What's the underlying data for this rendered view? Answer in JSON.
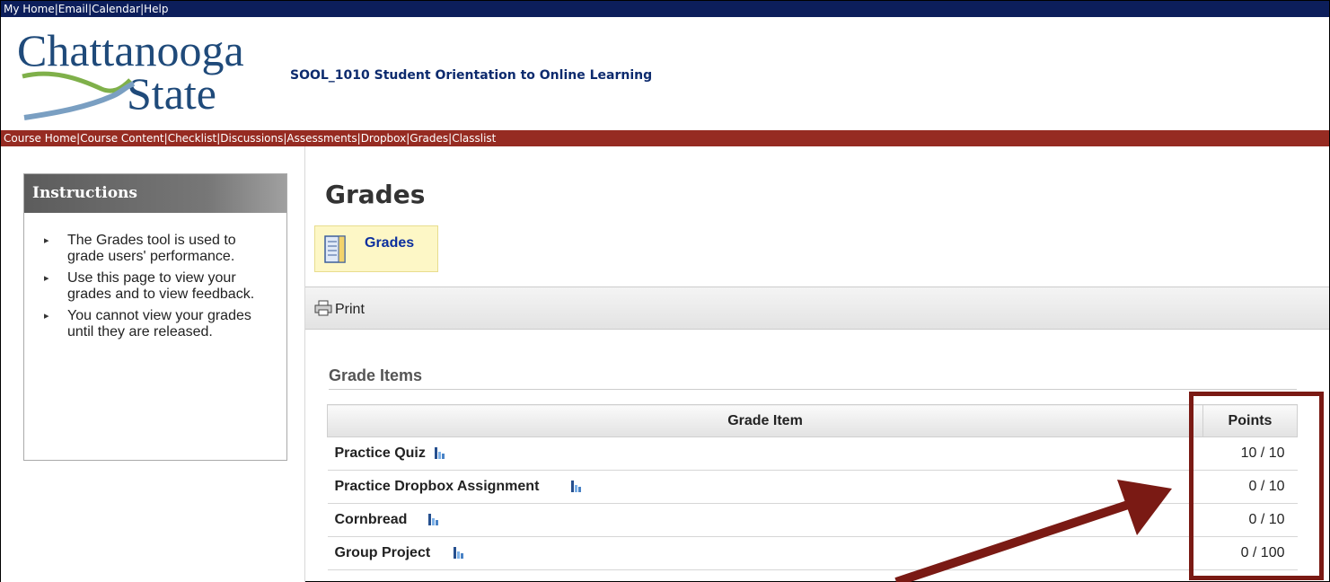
{
  "topbar": {
    "links": [
      "My Home",
      "Email",
      "Calendar",
      "Help"
    ],
    "separator": "|"
  },
  "header": {
    "logo_line1": "Chattanooga",
    "logo_line2": "State",
    "course_title": "SOOL_1010 Student Orientation to Online Learning"
  },
  "navbar": {
    "items": [
      "Course Home",
      "Course Content",
      "Checklist",
      "Discussions",
      "Assessments",
      "Dropbox",
      "Grades",
      "Classlist"
    ],
    "separator": "|"
  },
  "sidebar": {
    "title": "Instructions",
    "items": [
      "The Grades tool is used to grade users' performance.",
      "Use this page to view your grades and to view feedback.",
      "You cannot view your grades until they are released."
    ]
  },
  "main": {
    "page_title": "Grades",
    "tab_label": "Grades",
    "print_label": "Print",
    "section_title": "Grade Items",
    "table": {
      "headers": [
        "Grade Item",
        "Points"
      ],
      "rows": [
        {
          "item": "Practice Quiz",
          "points": "10 / 10"
        },
        {
          "item": "Practice Dropbox Assignment",
          "points": "0 / 10"
        },
        {
          "item": "Cornbread",
          "points": "0 / 10"
        },
        {
          "item": "Group Project",
          "points": "0 / 100"
        }
      ]
    }
  },
  "colors": {
    "topbar": "#0c1e5b",
    "navbar": "#962b22",
    "annotation": "#7a1a14",
    "link": "#0b2f9e"
  },
  "icons": [
    "grades-book-icon",
    "printer-icon",
    "statistics-icon",
    "bullet-arrow-icon"
  ]
}
